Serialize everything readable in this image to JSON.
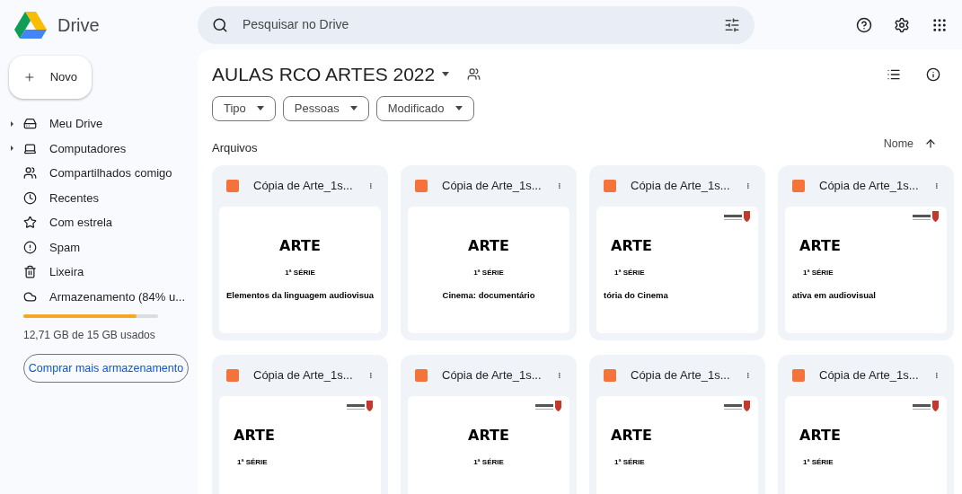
{
  "app": {
    "name": "Drive"
  },
  "search": {
    "placeholder": "Pesquisar no Drive"
  },
  "new_button": {
    "label": "Novo"
  },
  "sidebar": {
    "items": [
      {
        "label": "Meu Drive",
        "expandable": true
      },
      {
        "label": "Computadores",
        "expandable": true
      },
      {
        "label": "Compartilhados comigo",
        "expandable": false
      },
      {
        "label": "Recentes",
        "expandable": false
      },
      {
        "label": "Com estrela",
        "expandable": false
      },
      {
        "label": "Spam",
        "expandable": false
      },
      {
        "label": "Lixeira",
        "expandable": false
      },
      {
        "label": "Armazenamento (84% u...",
        "expandable": false
      }
    ]
  },
  "storage": {
    "level": 0.84,
    "usage": "12,71 GB de 15 GB usados",
    "buy_button": "Comprar mais armazenamento"
  },
  "folder": {
    "title": "AULAS RCO ARTES 2022"
  },
  "filters": [
    {
      "label": "Tipo"
    },
    {
      "label": "Pessoas"
    },
    {
      "label": "Modificado"
    }
  ],
  "section": {
    "title": "Arquivos",
    "sort": "Nome"
  },
  "files": [
    {
      "name": "Cópia de Arte_1s...",
      "logo": false,
      "kind": "centered",
      "slide": {
        "title": "ARTE",
        "grade": "1ª SÉRIE",
        "topic": "Elementos da linguagem audiovisua"
      }
    },
    {
      "name": "Cópia de Arte_1s...",
      "logo": false,
      "kind": "centered",
      "slide": {
        "title": "ARTE",
        "grade": "1ª SÉRIE",
        "topic": "Cinema: documentário"
      }
    },
    {
      "name": "Cópia de Arte_1s...",
      "logo": true,
      "kind": "left",
      "slide": {
        "title": "ARTE",
        "grade": "1ª SÉRIE",
        "topic": "tória do Cinema"
      }
    },
    {
      "name": "Cópia de Arte_1s...",
      "logo": true,
      "kind": "left",
      "slide": {
        "title": "ARTE",
        "grade": "1ª SÉRIE",
        "topic": "ativa em audiovisual"
      }
    },
    {
      "name": "Cópia de Arte_1s...",
      "logo": true,
      "kind": "left",
      "slide": {
        "title": "ARTE",
        "grade": "1ª SÉRIE"
      }
    },
    {
      "name": "Cópia de Arte_1s...",
      "logo": true,
      "kind": "centered",
      "slide": {
        "title": "ARTE",
        "grade": "1ª SÉRIE"
      }
    },
    {
      "name": "Cópia de Arte_1s...",
      "logo": true,
      "kind": "left",
      "slide": {
        "title": "ARTE",
        "grade": "1ª SÉRIE"
      }
    },
    {
      "name": "Cópia de Arte_1s...",
      "logo": true,
      "kind": "left",
      "slide": {
        "title": "ARTE",
        "grade": "1ª SÉRIE"
      }
    }
  ]
}
